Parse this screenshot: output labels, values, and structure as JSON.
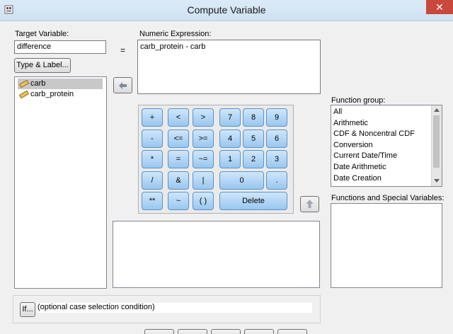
{
  "window": {
    "title": "Compute Variable",
    "close_glyph": "✕"
  },
  "target": {
    "label": "Target Variable:",
    "value": "difference"
  },
  "equals": "=",
  "type_label_button": "Type & Label...",
  "numeric_expression": {
    "label": "Numeric Expression:",
    "value": "carb_protein - carb"
  },
  "variables": [
    "carb",
    "carb_protein"
  ],
  "keypad": {
    "lt": "<",
    "gt": ">",
    "plus": "+",
    "minus": "-",
    "le": "<=",
    "ge": ">=",
    "mul": "*",
    "eq": "=",
    "ne": "~=",
    "div": "/",
    "amp": "&",
    "pipe": "|",
    "pow": "**",
    "tilde": "~",
    "parens": "( )",
    "d7": "7",
    "d8": "8",
    "d9": "9",
    "d4": "4",
    "d5": "5",
    "d6": "6",
    "d1": "1",
    "d2": "2",
    "d3": "3",
    "d0": "0",
    "dot": ".",
    "delete": "Delete"
  },
  "function_group": {
    "label": "Function group:",
    "items": [
      "All",
      "Arithmetic",
      "CDF & Noncentral CDF",
      "Conversion",
      "Current Date/Time",
      "Date Arithmetic",
      "Date Creation"
    ]
  },
  "functions_special": {
    "label": "Functions and Special Variables:"
  },
  "if_button": "If...",
  "if_condition": "(optional case selection condition)",
  "colors": {
    "keypad": "#a8d1f5",
    "selected": "#c8c8c8",
    "close": "#c9483c"
  }
}
